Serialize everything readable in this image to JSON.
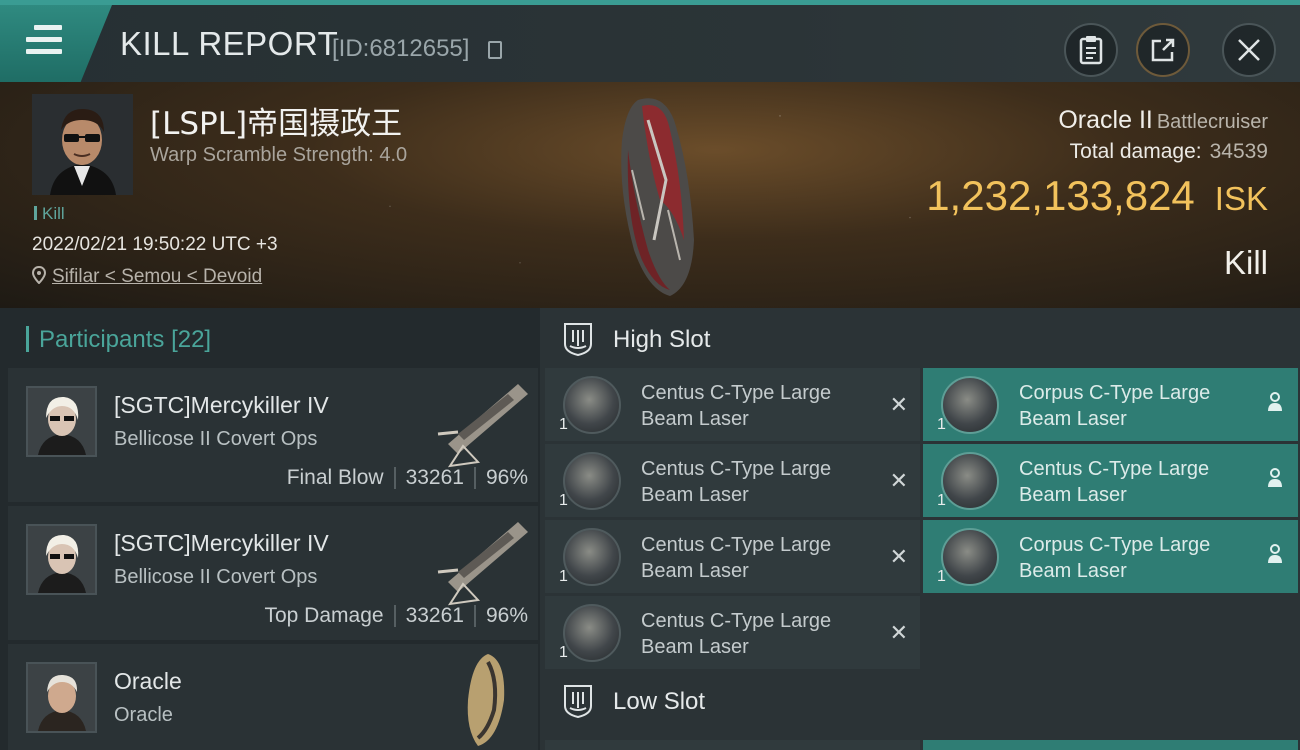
{
  "header": {
    "title": "KILL REPORT",
    "report_id": "[ID:6812655]"
  },
  "victim": {
    "name": "[LSPL]帝国摄政王",
    "warp_scramble": "Warp Scramble Strength: 4.0",
    "tag": "Kill",
    "datetime": "2022/02/21 19:50:22 UTC +3",
    "location": "Sifilar < Semou < Devoid"
  },
  "ship": {
    "name": "Oracle II",
    "class": "Battlecruiser",
    "total_damage_label": "Total damage:",
    "total_damage": "34539",
    "isk_value": "1,232,133,824",
    "isk_unit": "ISK",
    "result": "Kill"
  },
  "participants": {
    "label": "Participants",
    "count": "[22]",
    "rows": [
      {
        "name": "[SGTC]Mercykiller IV",
        "ship": "Bellicose II Covert Ops",
        "role": "Final Blow",
        "damage": "33261",
        "percent": "96%"
      },
      {
        "name": "[SGTC]Mercykiller IV",
        "ship": "Bellicose II Covert Ops",
        "role": "Top Damage",
        "damage": "33261",
        "percent": "96%"
      },
      {
        "name": "Oracle",
        "ship": "Oracle"
      }
    ]
  },
  "fitting": {
    "high_slot_label": "High Slot",
    "low_slot_label": "Low Slot",
    "destroyed_modules": [
      {
        "name": "Centus C-Type Large Beam Laser",
        "qty": "1"
      },
      {
        "name": "Centus C-Type Large Beam Laser",
        "qty": "1"
      },
      {
        "name": "Centus C-Type Large Beam Laser",
        "qty": "1"
      },
      {
        "name": "Centus C-Type Large Beam Laser",
        "qty": "1"
      }
    ],
    "dropped_modules": [
      {
        "name": "Corpus C-Type Large Beam Laser",
        "qty": "1"
      },
      {
        "name": "Centus C-Type Large Beam Laser",
        "qty": "1"
      },
      {
        "name": "Corpus C-Type Large Beam Laser",
        "qty": "1"
      }
    ]
  },
  "colors": {
    "accent": "#3a9c93",
    "isk_gold": "#f2c25c",
    "dropped_bg": "#2f7d74"
  }
}
